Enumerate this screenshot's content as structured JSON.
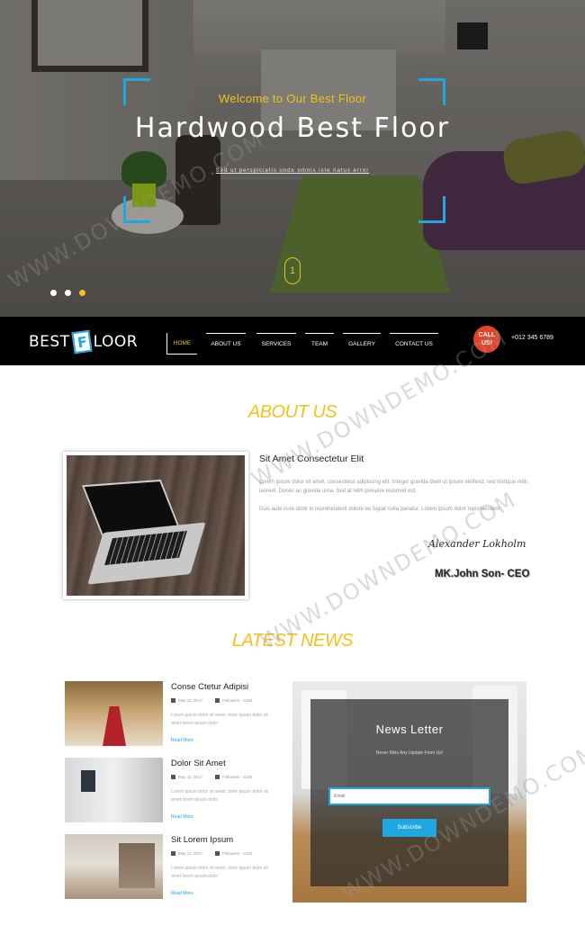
{
  "hero": {
    "welcome": "Welcome to Our Best Floor",
    "title": "Hardwood Best Floor",
    "subtitle": "Sed ut perspiciatis unde omnis iste natus error",
    "slide_number": "1",
    "dots": 3,
    "active_dot": 3
  },
  "brand": {
    "logo_left": "BEST",
    "logo_right": "LOOR"
  },
  "nav": {
    "items": [
      "HOME",
      "ABOUT US",
      "SERVICES",
      "TEAM",
      "GALLERY",
      "CONTACT US"
    ],
    "active": "HOME",
    "call_label": "CALL US!",
    "phone": "+012 345 6789"
  },
  "about": {
    "title": "ABOUT US",
    "heading": "Sit Amet Consectetur Elit",
    "paragraph1": "Lorem ipsum dolor sit amet, consectetur adipiscing elit. Integer gravida diam ut ipsum eleifend, sed tristique nibh laoreet. Donec ac gravida urna. Sed at nibh posuere euismod est.",
    "paragraph2": "Duis aute irure dolor in reprehenderit dolore eu fugiat nulla pariatur. Lorem ipsum dolor reprehenderit",
    "signature": "Alexander Lokholm",
    "ceo": "MK.John Son- CEO"
  },
  "news": {
    "title": "LATEST NEWS",
    "items": [
      {
        "title": "Conse Ctetur Adipisi",
        "date": "May 11, 2017",
        "author": "Fellowers - 2345",
        "text": "Lorem ipsum dolor sit amet, dolor ipsum dolor sit amet lorem ipsum dolor",
        "more": "Read More"
      },
      {
        "title": "Dolor Sit Amet",
        "date": "May 11, 2017",
        "author": "Fellowers - 2345",
        "text": "Lorem ipsum dolor sit amet, dolor ipsum dolor sit amet lorem ipsum dolor",
        "more": "Read More"
      },
      {
        "title": "Sit Lorem Ipsum",
        "date": "May 11, 2017",
        "author": "Fellowers - 2345",
        "text": "Lorem ipsum dolor sit amet, dolor ipsum dolor sit amet lorem ipsum dolor",
        "more": "Read More"
      }
    ]
  },
  "newsletter": {
    "title": "News Letter",
    "subtitle": "Never Miss Any Update From Us!",
    "email_placeholder": "Email",
    "subscribe_label": "Subscribe"
  },
  "watermark": "WWW.DOWNDEMO.COM",
  "colors": {
    "accent": "#f2c21b",
    "blue": "#1ea7e1",
    "nav_bg": "#000000",
    "call_badge": "#e0452b"
  }
}
